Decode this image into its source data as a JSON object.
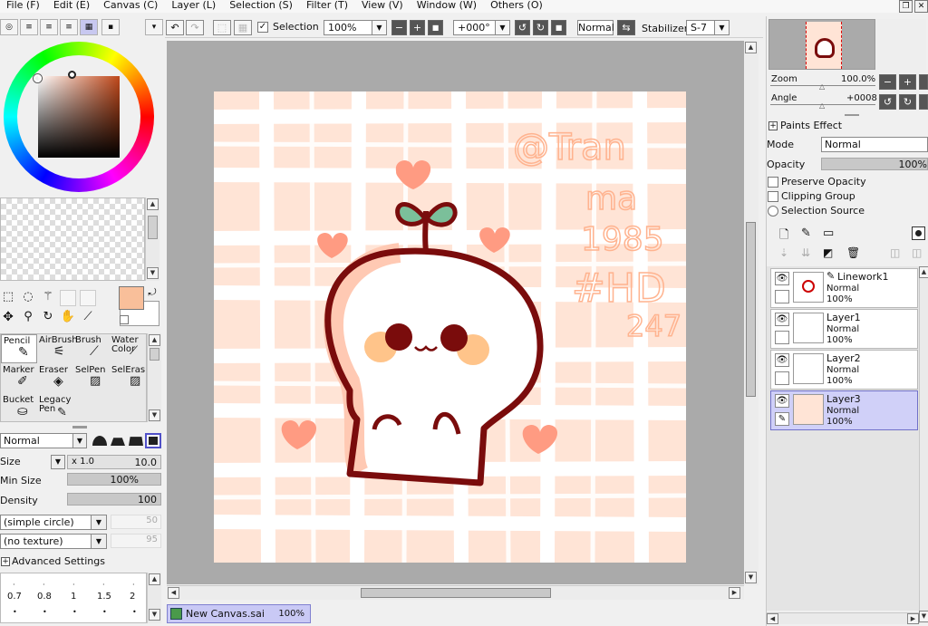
{
  "menu": [
    "File (F)",
    "Edit (E)",
    "Canvas (C)",
    "Layer (L)",
    "Selection (S)",
    "Filter (T)",
    "View (V)",
    "Window (W)",
    "Others (O)"
  ],
  "window_controls": {
    "restore": "❐",
    "close": "✕"
  },
  "toolbar": {
    "selection_label": "Selection",
    "zoom_value": "100%",
    "rotation_value": "+000°",
    "blend_mode": "Normal",
    "stabilizer_label": "Stabilizer",
    "stabilizer_value": "S-7"
  },
  "colors": {
    "primary": "#f9bf9a",
    "secondary": "#ffffff",
    "canvas_bg": "#ffe4d6",
    "stroke": "#7a0c0c"
  },
  "tools": {
    "row1": [
      {
        "label": "Pencil",
        "selected": true
      },
      {
        "label": "AirBrush"
      },
      {
        "label": "Brush"
      },
      {
        "label": "Water Color"
      }
    ],
    "row2": [
      {
        "label": "Marker"
      },
      {
        "label": "Eraser"
      },
      {
        "label": "SelPen"
      },
      {
        "label": "SelEras"
      }
    ],
    "row3": [
      {
        "label": "Bucket"
      },
      {
        "label": "Legacy Pen"
      }
    ]
  },
  "brush": {
    "mode": "Normal",
    "size_label": "Size",
    "size_multiplier": "x 1.0",
    "size_value": "10.0",
    "min_size_label": "Min Size",
    "min_size_value": "100%",
    "density_label": "Density",
    "density_value": "100",
    "shape": "(simple circle)",
    "shape_value": "50",
    "texture": "(no texture)",
    "texture_value": "95",
    "advanced_label": "Advanced Settings",
    "size_presets": [
      "0.7",
      "0.8",
      "1",
      "1.5",
      "2"
    ]
  },
  "document": {
    "name": "New Canvas.sai",
    "zoom": "100%"
  },
  "artwork": {
    "signature_lines": [
      "@Tran",
      "ma",
      "1985",
      "#HD",
      "247"
    ]
  },
  "navigator": {
    "zoom_label": "Zoom",
    "zoom_value": "100.0%",
    "angle_label": "Angle",
    "angle_value": "+0008"
  },
  "layers_panel": {
    "paints_effect": "Paints Effect",
    "mode_label": "Mode",
    "mode_value": "Normal",
    "opacity_label": "Opacity",
    "opacity_value": "100%",
    "preserve_opacity": "Preserve Opacity",
    "clipping_group": "Clipping Group",
    "selection_source": "Selection Source",
    "layers": [
      {
        "name": "Linework1",
        "mode": "Normal",
        "opacity": "100%",
        "selected": false
      },
      {
        "name": "Layer1",
        "mode": "Normal",
        "opacity": "100%",
        "selected": false
      },
      {
        "name": "Layer2",
        "mode": "Normal",
        "opacity": "100%",
        "selected": false
      },
      {
        "name": "Layer3",
        "mode": "Normal",
        "opacity": "100%",
        "selected": true
      }
    ]
  }
}
